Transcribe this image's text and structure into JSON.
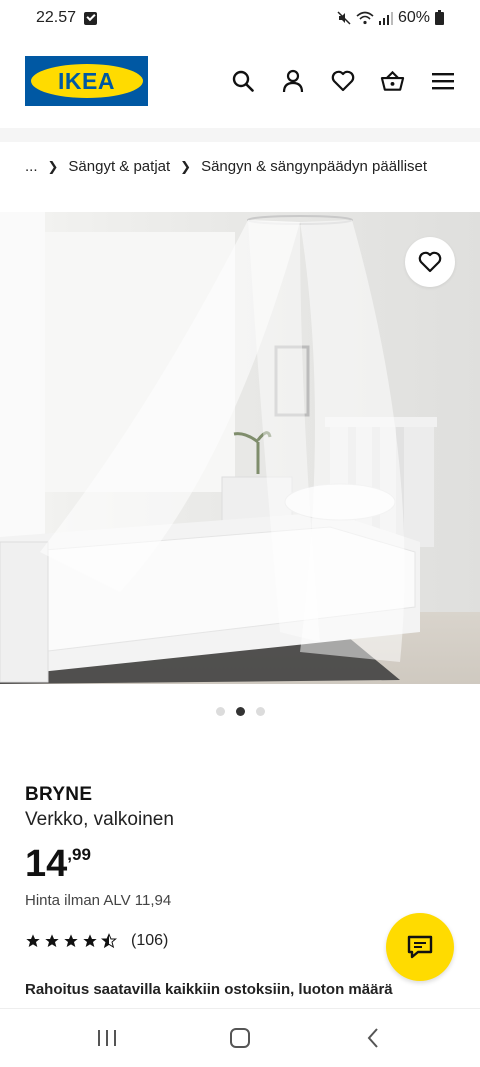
{
  "status_bar": {
    "time": "22.57",
    "battery": "60%"
  },
  "header": {
    "logo_text": "IKEA",
    "icons": [
      "search-icon",
      "user-icon",
      "heart-icon",
      "basket-icon",
      "menu-icon"
    ]
  },
  "breadcrumb": {
    "items": [
      "...",
      "Sängyt & patjat",
      "Sängyn & sängynpäädyn päälliset"
    ]
  },
  "gallery": {
    "dot_count": 3,
    "active_index": 1
  },
  "product": {
    "name": "BRYNE",
    "description": "Verkko, valkoinen",
    "price_main": "14",
    "price_decimals": ",99",
    "price_without_vat": "Hinta ilman ALV 11,94",
    "rating_value": 4.5,
    "rating_count": "(106)",
    "financing_text": "Rahoitus saatavilla kaikkiin ostoksiin, luoton määrä"
  },
  "colors": {
    "ikea_blue": "#0058a3",
    "ikea_yellow": "#ffdb00"
  }
}
